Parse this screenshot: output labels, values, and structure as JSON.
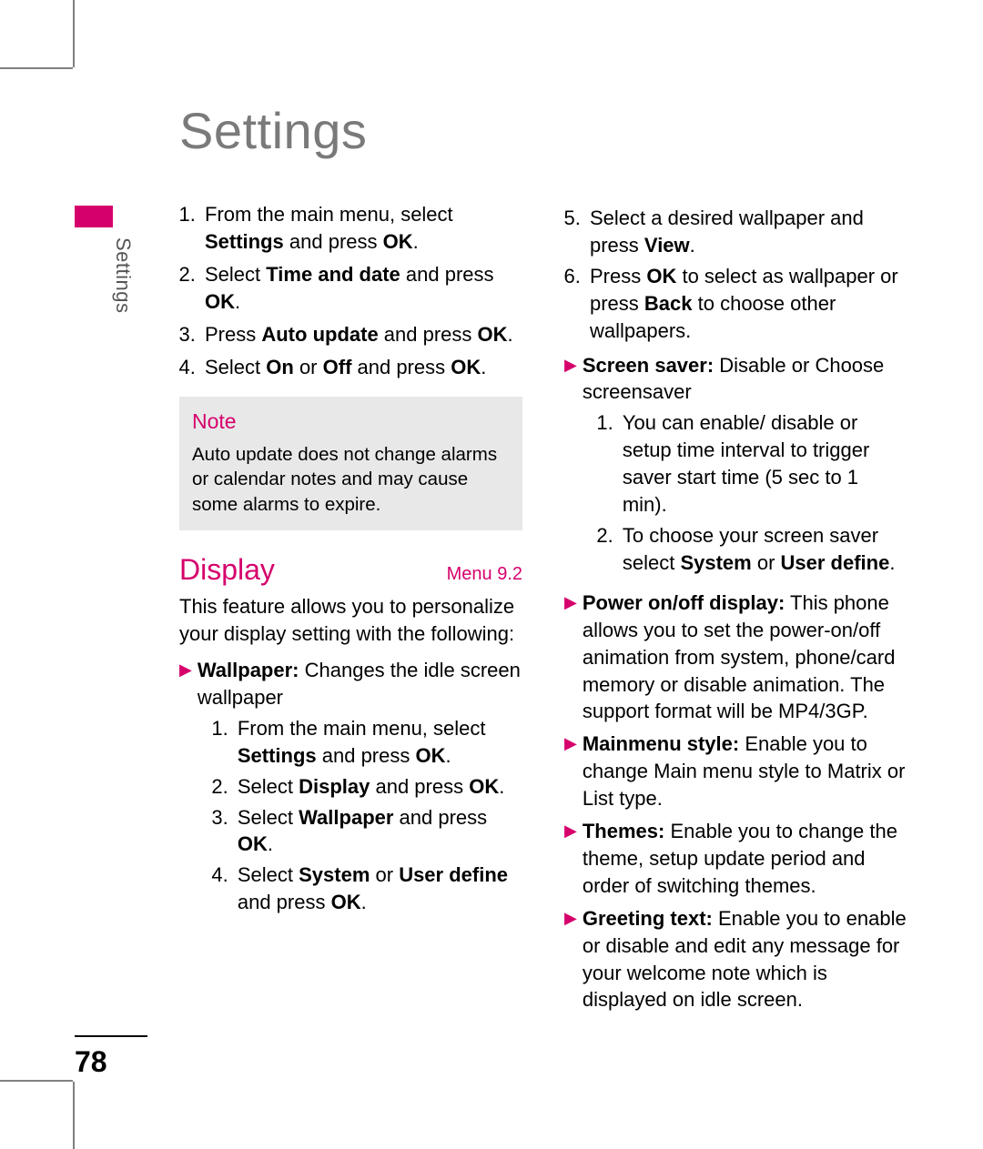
{
  "page_number": "78",
  "side_label": "Settings",
  "title": "Settings",
  "accent_color": "#d6006c",
  "steps_top": {
    "s1a": "From the main menu, select ",
    "s1b": "Settings",
    "s1c": " and press ",
    "s1d": "OK",
    "s1e": ".",
    "s2a": "Select ",
    "s2b": "Time and date",
    "s2c": " and press ",
    "s2d": "OK",
    "s2e": ".",
    "s3a": "Press ",
    "s3b": "Auto update",
    "s3c": " and press ",
    "s3d": "OK",
    "s3e": ".",
    "s4a": "Select ",
    "s4b": "On",
    "s4c": " or ",
    "s4d": "Off",
    "s4e": " and press ",
    "s4f": "OK",
    "s4g": "."
  },
  "note": {
    "title": "Note",
    "text": "Auto update does not change alarms or calendar notes and may cause some alarms to expire."
  },
  "section": {
    "name": "Display",
    "menu": "Menu 9.2"
  },
  "intro": "This feature allows you to personalize your display setting with the following:",
  "wallpaper": {
    "label": "Wallpaper:",
    "desc": " Changes the idle screen wallpaper",
    "w1a": "From the main menu, select ",
    "w1b": "Settings",
    "w1c": " and press ",
    "w1d": "OK",
    "w1e": ".",
    "w2a": "Select ",
    "w2b": "Display",
    "w2c": " and press ",
    "w2d": "OK",
    "w2e": ".",
    "w3a": "Select ",
    "w3b": "Wallpaper",
    "w3c": " and press ",
    "w3d": "OK",
    "w3e": ".",
    "w4a": "Select ",
    "w4b": "System",
    "w4c": " or ",
    "w4d": "User define",
    "w4e": " and press ",
    "w4f": "OK",
    "w4g": ".",
    "w5a": "Select a desired wallpaper and press ",
    "w5b": "View",
    "w5c": ".",
    "w6a": "Press ",
    "w6b": "OK",
    "w6c": " to select as wallpaper or press ",
    "w6d": "Back",
    "w6e": " to choose other wallpapers."
  },
  "screensaver": {
    "label": "Screen saver:",
    "desc": " Disable or Choose screensaver",
    "ss1": "You can enable/ disable or setup time interval to trigger saver start time (5 sec to 1 min).",
    "ss2a": "To choose your screen saver select ",
    "ss2b": "System",
    "ss2c": " or ",
    "ss2d": "User define",
    "ss2e": "."
  },
  "power": {
    "label": "Power on/off display:",
    "desc": " This phone allows you to set the power-on/off animation from system, phone/card memory or disable animation. The support format will be MP4/3GP."
  },
  "mainmenu": {
    "label": "Mainmenu style:",
    "desc": " Enable you to change Main menu style to Matrix or List type."
  },
  "themes": {
    "label": "Themes:",
    "desc": " Enable you to change the theme, setup update period and order of switching themes."
  },
  "greeting": {
    "label": "Greeting text:",
    "desc": " Enable you to enable or disable and edit any message for your welcome note which is displayed on idle screen."
  }
}
